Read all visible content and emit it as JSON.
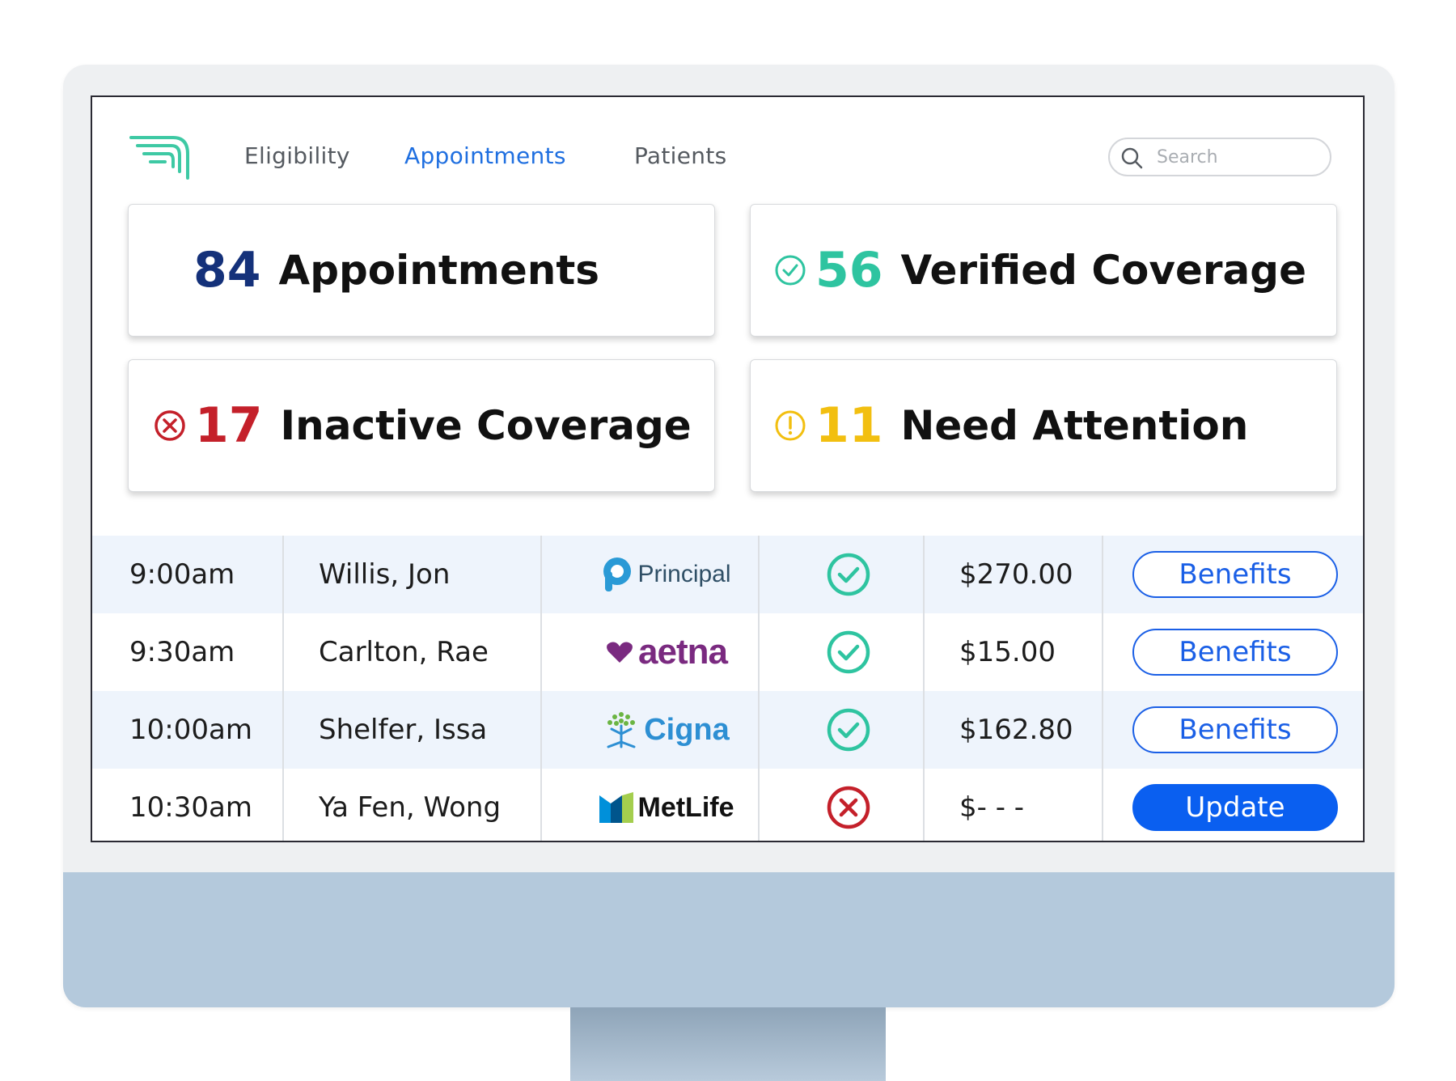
{
  "nav": {
    "items": [
      {
        "label": "Eligibility",
        "active": false
      },
      {
        "label": "Appointments",
        "active": true
      },
      {
        "label": "Patients",
        "active": false
      }
    ],
    "search_placeholder": "Search"
  },
  "stats": [
    {
      "value": "84",
      "label": "Appointments",
      "color": "#14317a",
      "icon": ""
    },
    {
      "value": "56",
      "label": "Verified Coverage",
      "color": "#2ec4a0",
      "icon": "check-circle-icon"
    },
    {
      "value": "17",
      "label": "Inactive Coverage",
      "color": "#c4202a",
      "icon": "x-circle-icon"
    },
    {
      "value": "11",
      "label": "Need Attention",
      "color": "#f2bf10",
      "icon": "alert-circle-icon"
    }
  ],
  "appointments": [
    {
      "time": "9:00am",
      "patient": "Willis, Jon",
      "insurer": "Principal",
      "status": "verified",
      "amount": "$270.00",
      "action": "Benefits"
    },
    {
      "time": "9:30am",
      "patient": "Carlton, Rae",
      "insurer": "aetna",
      "status": "verified",
      "amount": "$15.00",
      "action": "Benefits"
    },
    {
      "time": "10:00am",
      "patient": "Shelfer, Issa",
      "insurer": "Cigna",
      "status": "verified",
      "amount": "$162.80",
      "action": "Benefits"
    },
    {
      "time": "10:30am",
      "patient": "Ya Fen, Wong",
      "insurer": "MetLife",
      "status": "inactive",
      "amount": "$- - -",
      "action": "Update"
    }
  ],
  "colors": {
    "accent": "#1a5fe6",
    "verified": "#2ec4a0",
    "inactive": "#c4202a",
    "attention": "#f2bf10",
    "row_shade": "#eef4fc"
  }
}
